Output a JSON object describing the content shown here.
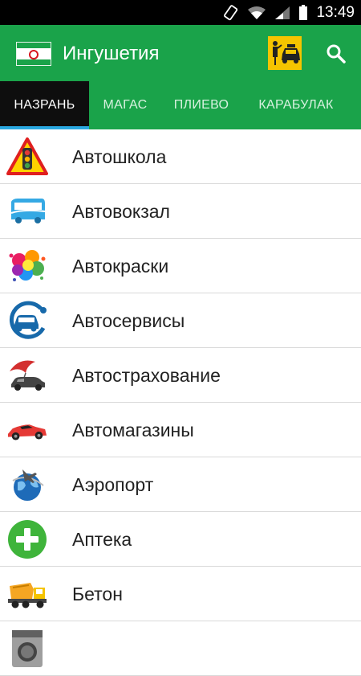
{
  "status": {
    "time": "13:49"
  },
  "header": {
    "title": "Ингушетия"
  },
  "tabs": [
    {
      "label": "НАЗРАНЬ"
    },
    {
      "label": "МАГАС"
    },
    {
      "label": "ПЛИЕВО"
    },
    {
      "label": "КАРАБУЛАК"
    }
  ],
  "categories": [
    {
      "label": "Автошкола",
      "icon": "traffic-light-sign-icon"
    },
    {
      "label": "Автовокзал",
      "icon": "bus-icon"
    },
    {
      "label": "Автокраски",
      "icon": "paint-splash-icon"
    },
    {
      "label": "Автосервисы",
      "icon": "car-service-icon"
    },
    {
      "label": "Автострахование",
      "icon": "car-umbrella-icon"
    },
    {
      "label": "Автомагазины",
      "icon": "sports-car-icon"
    },
    {
      "label": "Аэропорт",
      "icon": "airplane-globe-icon"
    },
    {
      "label": "Аптека",
      "icon": "pharmacy-cross-icon"
    },
    {
      "label": "Бетон",
      "icon": "concrete-mixer-truck-icon"
    },
    {
      "label": "",
      "icon": "washing-machine-icon"
    }
  ],
  "colors": {
    "primary": "#1aa34a",
    "tab_active_bg": "#0e0e0e",
    "tab_indicator": "#29a8e0"
  }
}
